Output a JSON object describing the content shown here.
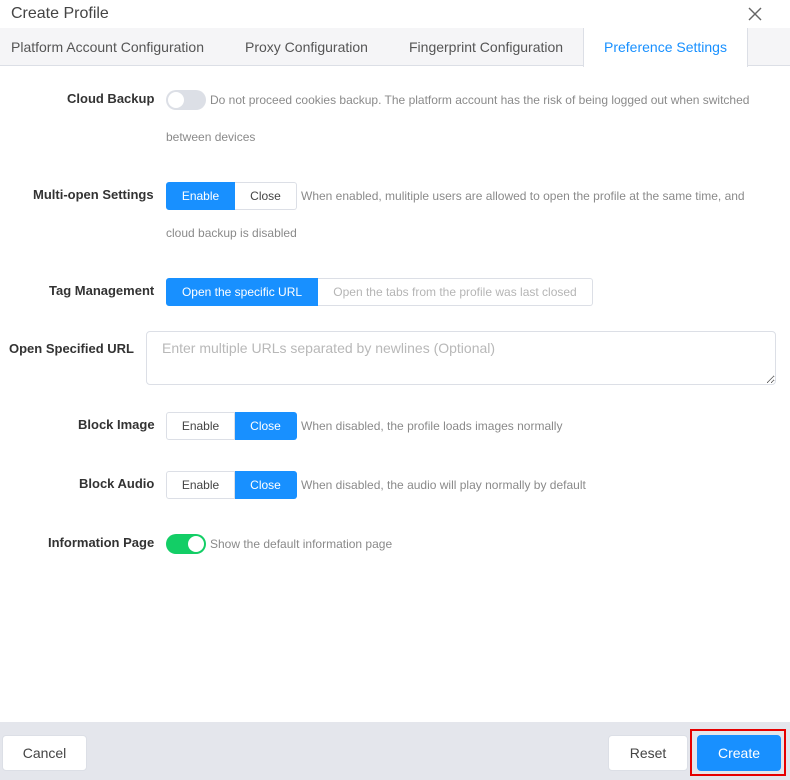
{
  "dialog": {
    "title": "Create Profile"
  },
  "tabs": [
    {
      "label": "Platform Account Configuration",
      "active": false
    },
    {
      "label": "Proxy Configuration",
      "active": false
    },
    {
      "label": "Fingerprint Configuration",
      "active": false
    },
    {
      "label": "Preference Settings",
      "active": true
    }
  ],
  "settings": {
    "cloud_backup": {
      "label": "Cloud Backup",
      "enabled": false,
      "hint_line1": "Do not proceed cookies backup. The platform account has the risk of being logged out when switched",
      "hint_line2": "between devices"
    },
    "multi_open": {
      "label": "Multi-open Settings",
      "options": [
        "Enable",
        "Close"
      ],
      "selected": "Enable",
      "hint_line1": "When enabled, mulitiple users are allowed to open the profile at the same time, and",
      "hint_line2": "cloud backup is disabled"
    },
    "tag_management": {
      "label": "Tag Management",
      "options": [
        "Open the specific URL",
        "Open the tabs from the profile was last closed"
      ],
      "selected": "Open the specific URL"
    },
    "open_url": {
      "label": "Open Specified URL",
      "placeholder": "Enter multiple URLs separated by newlines (Optional)",
      "value": ""
    },
    "block_image": {
      "label": "Block Image",
      "options": [
        "Enable",
        "Close"
      ],
      "selected": "Close",
      "hint": "When disabled, the profile loads images normally"
    },
    "block_audio": {
      "label": "Block Audio",
      "options": [
        "Enable",
        "Close"
      ],
      "selected": "Close",
      "hint": "When disabled, the audio will play normally by default"
    },
    "information_page": {
      "label": "Information Page",
      "enabled": true,
      "hint": "Show the default information page"
    }
  },
  "footer": {
    "cancel_label": "Cancel",
    "reset_label": "Reset",
    "create_label": "Create"
  },
  "colors": {
    "primary": "#1890ff",
    "toggle_on": "#13ce66",
    "highlight": "#e60000"
  }
}
